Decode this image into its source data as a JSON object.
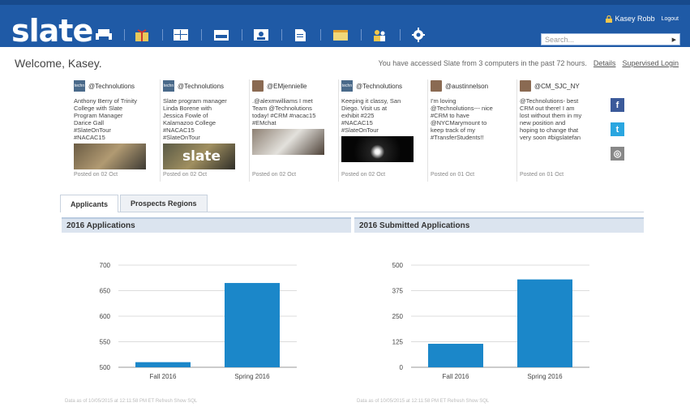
{
  "app": {
    "logo": "slate"
  },
  "user": {
    "name": "Kasey Robb",
    "logout": "Logout"
  },
  "search": {
    "placeholder": "Search..."
  },
  "nav": {
    "icons": [
      "printer-icon",
      "gift-icon",
      "layout-icon",
      "inbox-icon",
      "user-card-icon",
      "document-icon",
      "calendar-icon",
      "users-icon",
      "gear-icon"
    ]
  },
  "welcome": "Welcome, Kasey.",
  "access": {
    "message": "You have accessed Slate from 3 computers in the past 72 hours.",
    "details": "Details",
    "supervised": "Supervised Login"
  },
  "feed": [
    {
      "handle": "@Technolutions",
      "avatar": "techno",
      "text": "Anthony Berry of Trinity\nCollege with Slate\nProgram Manager\nDarice Gall\n#SlateOnTour\n#NACAC15",
      "image": "a",
      "date": "Posted on 02 Oct"
    },
    {
      "handle": "@Technolutions",
      "avatar": "techno",
      "text": "Slate program manager\nLinda Borene with\nJessica Fowle of\nKalamazoo College\n#NACAC15\n#SlateOnTour",
      "image": "b",
      "date": "Posted on 02 Oct"
    },
    {
      "handle": "@EMjennielle",
      "avatar": "photo",
      "text": ".@alexmwilliams I met\nTeam @Technolutions\ntoday! #CRM #nacac15\n#EMchat",
      "image": "c",
      "date": "Posted on 02 Oct"
    },
    {
      "handle": "@Technolutions",
      "avatar": "techno",
      "text": "Keeping it classy, San\nDiego. Visit us at\nexhibit #225\n#NACAC15\n#SlateOnTour",
      "image": "d",
      "date": "Posted on 02 Oct"
    },
    {
      "handle": "@austinnelson",
      "avatar": "photo",
      "text": "I'm loving\n@Technolutions--- nice\n#CRM to have\n@NYCMarymount to\nkeep track of my\n#TransferStudents!!",
      "image": "",
      "date": "Posted on 01 Oct"
    },
    {
      "handle": "@CM_SJC_NY",
      "avatar": "photo",
      "text": "@Technolutions- best\nCRM out there! I am\nlost without them in my\nnew position and\nhoping to change that\nvery soon #bigslatefan",
      "image": "",
      "date": "Posted on 01 Oct"
    }
  ],
  "social": [
    {
      "name": "facebook-icon",
      "glyph": "f"
    },
    {
      "name": "twitter-icon",
      "glyph": "t"
    },
    {
      "name": "instagram-icon",
      "glyph": "◎"
    }
  ],
  "tabs": [
    {
      "label": "Applicants",
      "active": true
    },
    {
      "label": "Prospects Regions",
      "active": false
    }
  ],
  "colors": {
    "header": "#1f5aa6",
    "bar": "#1b87c9"
  },
  "footnote": "Data as of 10/05/2015 at 12:11:58 PM ET   Refresh   Show SQL",
  "chart_data": [
    {
      "type": "bar",
      "title": "2016 Applications",
      "categories": [
        "Fall 2016",
        "Spring 2016"
      ],
      "values": [
        510,
        665
      ],
      "ylim": [
        500,
        700
      ],
      "yticks": [
        500,
        550,
        600,
        650,
        700
      ]
    },
    {
      "type": "bar",
      "title": "2016 Submitted Applications",
      "categories": [
        "Fall 2016",
        "Spring 2016"
      ],
      "values": [
        115,
        430
      ],
      "ylim": [
        0,
        500
      ],
      "yticks": [
        0,
        125,
        250,
        375,
        500
      ]
    }
  ]
}
